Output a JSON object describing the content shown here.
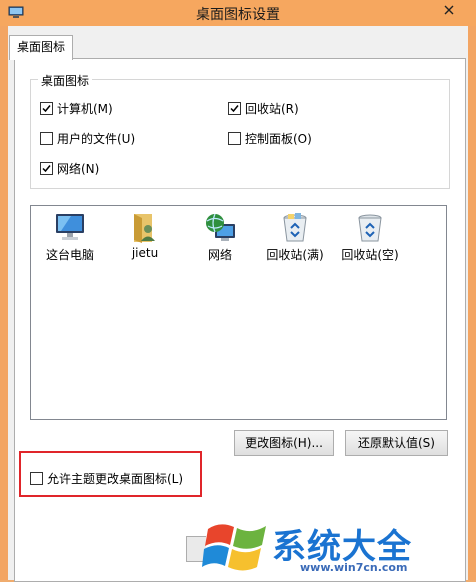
{
  "window": {
    "title": "桌面图标设置"
  },
  "tab": {
    "label": "桌面图标"
  },
  "desktop_icons_group": {
    "legend": "桌面图标",
    "checkboxes": [
      {
        "label": "计算机(M)",
        "checked": true
      },
      {
        "label": "回收站(R)",
        "checked": true
      },
      {
        "label": "用户的文件(U)",
        "checked": false
      },
      {
        "label": "控制面板(O)",
        "checked": false
      },
      {
        "label": "网络(N)",
        "checked": true
      }
    ]
  },
  "icon_list": {
    "items": [
      {
        "label": "这台电脑",
        "icon": "computer-icon"
      },
      {
        "label": "jietu",
        "icon": "user-folder-icon"
      },
      {
        "label": "网络",
        "icon": "network-icon"
      },
      {
        "label": "回收站(满)",
        "icon": "recycle-bin-full-icon"
      },
      {
        "label": "回收站(空)",
        "icon": "recycle-bin-empty-icon"
      }
    ]
  },
  "buttons": {
    "change_icon": "更改图标(H)...",
    "restore_default": "还原默认值(S)"
  },
  "allow_themes_checkbox": {
    "label": "允许主题更改桌面图标(L)",
    "checked": false
  },
  "watermark": {
    "brand": "系统大全",
    "url": "www.win7cn.com"
  },
  "colors": {
    "titlebar": "#f6a75f",
    "highlight": "#e0252a",
    "watermark_text": "#1a73d1"
  }
}
